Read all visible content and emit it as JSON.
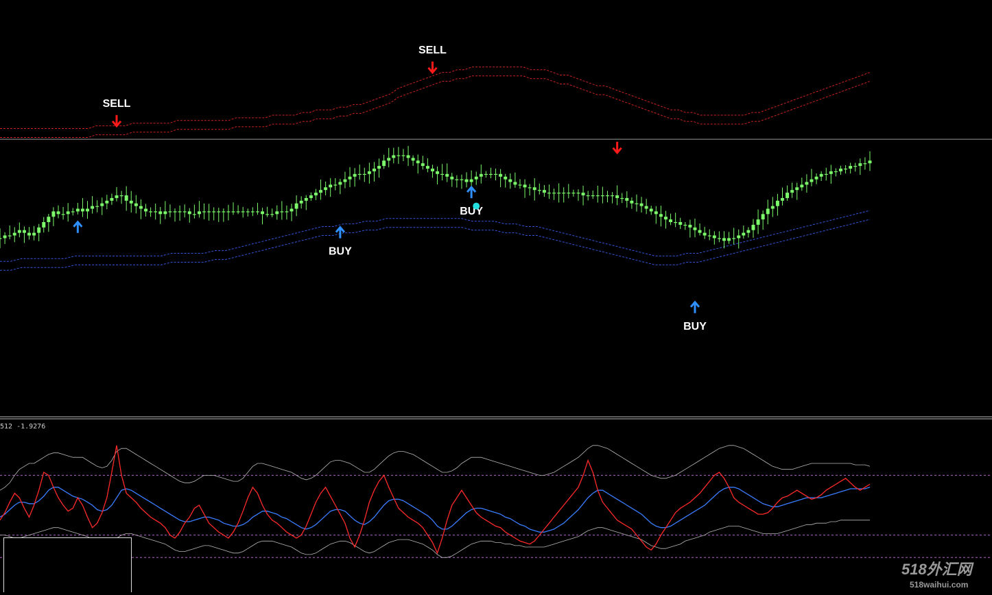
{
  "colors": {
    "background": "#000000",
    "candle": "#7CFC6A",
    "upper_band": "#cc2222",
    "lower_band": "#3355dd",
    "price_line": "#9a9a9a",
    "buy_arrow": "#2f8fff",
    "sell_arrow": "#ff1a1a",
    "dot": "#22e0e0",
    "osc_fast": "#ff2a2a",
    "osc_signal": "#3a7dff",
    "osc_envelope": "#b8b8b8",
    "osc_levels": "#b066cc",
    "separator": "#bdbdbd"
  },
  "indicator_readout": "512 -1.9276",
  "watermark": {
    "main": "518外汇网",
    "sub": "518waihui.com"
  },
  "chart_data": [
    {
      "type": "candlestick",
      "x_count": 180,
      "closes": [
        34,
        35,
        35,
        36,
        37,
        36,
        35,
        36,
        38,
        40,
        42,
        44,
        43,
        43,
        44,
        44,
        45,
        44,
        45,
        46,
        46,
        47,
        48,
        49,
        50,
        50,
        48,
        47,
        46,
        45,
        44,
        44,
        44,
        43,
        44,
        44,
        44,
        44,
        44,
        43,
        43,
        44,
        44,
        44,
        44,
        44,
        44,
        44,
        44,
        44,
        44,
        44,
        44,
        44,
        43,
        43,
        43,
        44,
        44,
        44,
        45,
        47,
        48,
        49,
        50,
        51,
        52,
        53,
        54,
        54,
        55,
        56,
        57,
        58,
        58,
        58,
        59,
        60,
        61,
        63,
        64,
        65,
        65,
        65,
        64,
        63,
        62,
        61,
        60,
        59,
        58,
        58,
        57,
        56,
        56,
        56,
        55,
        56,
        57,
        58,
        58,
        58,
        58,
        57,
        56,
        55,
        54,
        54,
        53,
        53,
        52,
        52,
        51,
        51,
        51,
        51,
        51,
        51,
        51,
        51,
        50,
        50,
        50,
        50,
        50,
        50,
        50,
        49,
        49,
        48,
        47,
        47,
        46,
        45,
        44,
        43,
        42,
        41,
        40,
        40,
        39,
        39,
        38,
        37,
        36,
        35,
        35,
        34,
        34,
        33,
        34,
        34,
        35,
        36,
        37,
        39,
        41,
        43,
        45,
        46,
        48,
        49,
        51,
        52,
        53,
        54,
        55,
        56,
        57,
        58,
        58,
        59,
        59,
        60,
        60,
        61,
        61,
        62,
        62,
        63
      ],
      "upper_band": [
        75,
        75,
        75,
        75,
        75,
        75,
        75,
        75,
        75,
        75,
        75,
        75,
        75,
        76,
        76,
        76,
        76,
        76,
        77,
        77,
        77,
        77,
        77,
        77,
        78,
        78,
        78,
        78,
        78,
        78,
        78,
        78,
        79,
        79,
        79,
        79,
        79,
        80,
        80,
        80,
        80,
        81,
        81,
        82,
        82,
        82,
        83,
        83,
        84,
        84,
        85,
        86,
        87,
        88,
        90,
        91,
        92,
        93,
        94,
        95,
        96,
        96,
        97,
        97,
        98,
        98,
        98,
        98,
        98,
        98,
        98,
        98,
        97,
        97,
        97,
        96,
        95,
        95,
        94,
        93,
        92,
        91,
        91,
        90,
        89,
        88,
        87,
        86,
        85,
        84,
        83,
        82,
        82,
        81,
        81,
        80,
        80,
        80,
        80,
        80,
        80,
        80,
        81,
        81,
        82,
        83,
        84,
        85,
        86,
        87,
        88,
        89,
        90,
        91,
        92,
        93,
        94,
        95,
        96
      ],
      "lower_band": [
        22,
        22,
        23,
        23,
        23,
        23,
        23,
        24,
        24,
        24,
        24,
        24,
        24,
        24,
        24,
        24,
        25,
        25,
        25,
        25,
        26,
        26,
        27,
        28,
        29,
        30,
        31,
        32,
        33,
        34,
        35,
        35,
        36,
        36,
        37,
        37,
        38,
        38,
        38,
        38,
        38,
        38,
        38,
        38,
        37,
        37,
        37,
        36,
        36,
        35,
        35,
        34,
        33,
        32,
        31,
        30,
        29,
        28,
        27,
        26,
        25,
        24,
        24,
        24,
        25,
        25,
        26,
        27,
        28,
        29,
        30,
        31,
        32,
        33,
        34,
        35,
        36,
        37,
        38,
        39,
        40,
        41
      ],
      "signals": [
        {
          "type": "buy",
          "i": 16,
          "value": 38,
          "label": ""
        },
        {
          "type": "sell",
          "i": 24,
          "value": 78,
          "label": "SELL"
        },
        {
          "type": "buy",
          "i": 70,
          "value": 36,
          "label": "BUY"
        },
        {
          "type": "sell",
          "i": 89,
          "value": 98,
          "label": "SELL"
        },
        {
          "type": "buy",
          "i": 97,
          "value": 51,
          "label": "BUY"
        },
        {
          "type": "sell",
          "i": 127,
          "value": 68,
          "label": ""
        },
        {
          "type": "buy",
          "i": 143,
          "value": 8,
          "label": "BUY"
        }
      ],
      "dot": {
        "i": 98,
        "value": 46
      },
      "price_line_value": 71,
      "ylim": [
        0,
        100
      ]
    },
    {
      "type": "line",
      "x_count": 180,
      "levels": [
        70,
        30,
        15
      ],
      "series": [
        {
          "role": "fast",
          "values": [
            40,
            45,
            52,
            58,
            55,
            48,
            42,
            50,
            60,
            72,
            70,
            62,
            55,
            50,
            46,
            48,
            55,
            50,
            42,
            35,
            38,
            45,
            55,
            72,
            90,
            70,
            58,
            55,
            52,
            48,
            45,
            42,
            40,
            38,
            35,
            30,
            28,
            32,
            38,
            42,
            48,
            50,
            44,
            38,
            35,
            32,
            30,
            28,
            32,
            38,
            46,
            55,
            62,
            58,
            50,
            44,
            40,
            38,
            35,
            32,
            30,
            28,
            30,
            36,
            44,
            52,
            58,
            62,
            56,
            50,
            44,
            38,
            28,
            22,
            30,
            40,
            52,
            60,
            66,
            70,
            62,
            55,
            48,
            45,
            42,
            40,
            38,
            35,
            30,
            25,
            18,
            28,
            40,
            50,
            55,
            60,
            55,
            50,
            45,
            42,
            40,
            38,
            36,
            35,
            32,
            30,
            28,
            26,
            25,
            24,
            26,
            30,
            34,
            38,
            42,
            46,
            50,
            54,
            58,
            62,
            70,
            80,
            72,
            60,
            52,
            48,
            44,
            40,
            38,
            36,
            34,
            30,
            26,
            22,
            20,
            24,
            30,
            35,
            40,
            45,
            48,
            50,
            52,
            55,
            58,
            62,
            66,
            70,
            72,
            68,
            62,
            55,
            52,
            50,
            48,
            46,
            44,
            44,
            45,
            48,
            52,
            55,
            56,
            58,
            60,
            58,
            56,
            54,
            55,
            57,
            60,
            62,
            64,
            66,
            68,
            65,
            62,
            60,
            62,
            64
          ]
        },
        {
          "role": "signal",
          "values": [
            42,
            44,
            47,
            50,
            52,
            52,
            51,
            51,
            53,
            56,
            60,
            62,
            62,
            60,
            58,
            56,
            55,
            54,
            52,
            50,
            47,
            46,
            47,
            50,
            55,
            60,
            61,
            60,
            58,
            56,
            54,
            52,
            50,
            48,
            46,
            44,
            42,
            40,
            39,
            39,
            40,
            41,
            42,
            42,
            41,
            40,
            38,
            37,
            36,
            36,
            37,
            39,
            42,
            44,
            46,
            46,
            45,
            44,
            42,
            41,
            39,
            37,
            35,
            34,
            35,
            37,
            40,
            43,
            46,
            47,
            47,
            46,
            43,
            40,
            38,
            37,
            39,
            42,
            46,
            50,
            53,
            54,
            54,
            53,
            51,
            49,
            47,
            45,
            43,
            40,
            36,
            34,
            34,
            36,
            39,
            42,
            45,
            47,
            48,
            48,
            47,
            46,
            45,
            44,
            42,
            41,
            39,
            37,
            36,
            34,
            33,
            32,
            32,
            33,
            34,
            36,
            38,
            41,
            44,
            47,
            51,
            55,
            58,
            60,
            60,
            58,
            56,
            54,
            52,
            50,
            48,
            46,
            44,
            41,
            38,
            36,
            35,
            35,
            36,
            38,
            40,
            42,
            44,
            46,
            48,
            50,
            53,
            56,
            59,
            61,
            62,
            62,
            61,
            59,
            57,
            55,
            53,
            51,
            50,
            49,
            49,
            50,
            51,
            52,
            53,
            54,
            55,
            55,
            55,
            55,
            56,
            57,
            58,
            59,
            60,
            61,
            61,
            61,
            61,
            62
          ]
        },
        {
          "role": "upper_envelope",
          "values": [
            60,
            62,
            65,
            70,
            74,
            76,
            78,
            78,
            80,
            82,
            84,
            85,
            85,
            84,
            83,
            82,
            82,
            82,
            80,
            78,
            76,
            75,
            76,
            80,
            86,
            88,
            88,
            86,
            84,
            82,
            80,
            78,
            76,
            74,
            72,
            70,
            68,
            66,
            65,
            65,
            66,
            68,
            70,
            70,
            70,
            69,
            68,
            67,
            66,
            66,
            68,
            72,
            76,
            78,
            78,
            77,
            76,
            75,
            74,
            73,
            72,
            70,
            68,
            67,
            68,
            70,
            73,
            76,
            79,
            80,
            80,
            79,
            78,
            76,
            74,
            72,
            72,
            74,
            77,
            80,
            83,
            85,
            86,
            86,
            85,
            84,
            82,
            80,
            78,
            76,
            74,
            72,
            72,
            73,
            75,
            78,
            80,
            82,
            82,
            82,
            81,
            80,
            79,
            78,
            77,
            76,
            75,
            74,
            73,
            72,
            71,
            70,
            70,
            71,
            72,
            74,
            76,
            78,
            80,
            82,
            85,
            88,
            90,
            90,
            89,
            88,
            86,
            84,
            82,
            80,
            78,
            76,
            74,
            72,
            70,
            69,
            68,
            68,
            69,
            70,
            72,
            74,
            76,
            78,
            80,
            82,
            84,
            86,
            88,
            89,
            90,
            90,
            89,
            88,
            86,
            84,
            82,
            80,
            78,
            76,
            75,
            74,
            74,
            74,
            75,
            76,
            77,
            78,
            78,
            78,
            78,
            78,
            78,
            78,
            78,
            78,
            77,
            77,
            77,
            76
          ]
        },
        {
          "role": "lower_envelope",
          "values": [
            30,
            30,
            29,
            28,
            28,
            29,
            30,
            31,
            32,
            33,
            34,
            35,
            35,
            34,
            33,
            32,
            31,
            30,
            29,
            27,
            26,
            25,
            25,
            26,
            28,
            30,
            31,
            31,
            30,
            29,
            28,
            27,
            26,
            25,
            24,
            22,
            20,
            19,
            19,
            20,
            21,
            22,
            23,
            23,
            22,
            21,
            20,
            19,
            18,
            18,
            19,
            21,
            23,
            25,
            26,
            26,
            26,
            25,
            24,
            23,
            22,
            20,
            18,
            17,
            17,
            18,
            20,
            22,
            24,
            25,
            26,
            26,
            25,
            23,
            21,
            19,
            18,
            19,
            21,
            23,
            25,
            26,
            27,
            27,
            27,
            26,
            25,
            24,
            22,
            20,
            17,
            15,
            15,
            16,
            18,
            20,
            22,
            24,
            25,
            26,
            26,
            26,
            25,
            25,
            24,
            24,
            23,
            23,
            22,
            22,
            22,
            22,
            22,
            23,
            24,
            25,
            26,
            27,
            28,
            29,
            31,
            33,
            34,
            35,
            35,
            34,
            33,
            32,
            31,
            30,
            29,
            28,
            27,
            25,
            23,
            22,
            21,
            21,
            22,
            23,
            24,
            26,
            27,
            28,
            29,
            30,
            32,
            33,
            34,
            35,
            36,
            36,
            36,
            35,
            34,
            33,
            32,
            31,
            31,
            31,
            31,
            32,
            33,
            34,
            35,
            36,
            37,
            37,
            38,
            38,
            38,
            39,
            39,
            40,
            40,
            40,
            40,
            40,
            40,
            40
          ]
        }
      ],
      "ylim": [
        0,
        100
      ]
    }
  ]
}
